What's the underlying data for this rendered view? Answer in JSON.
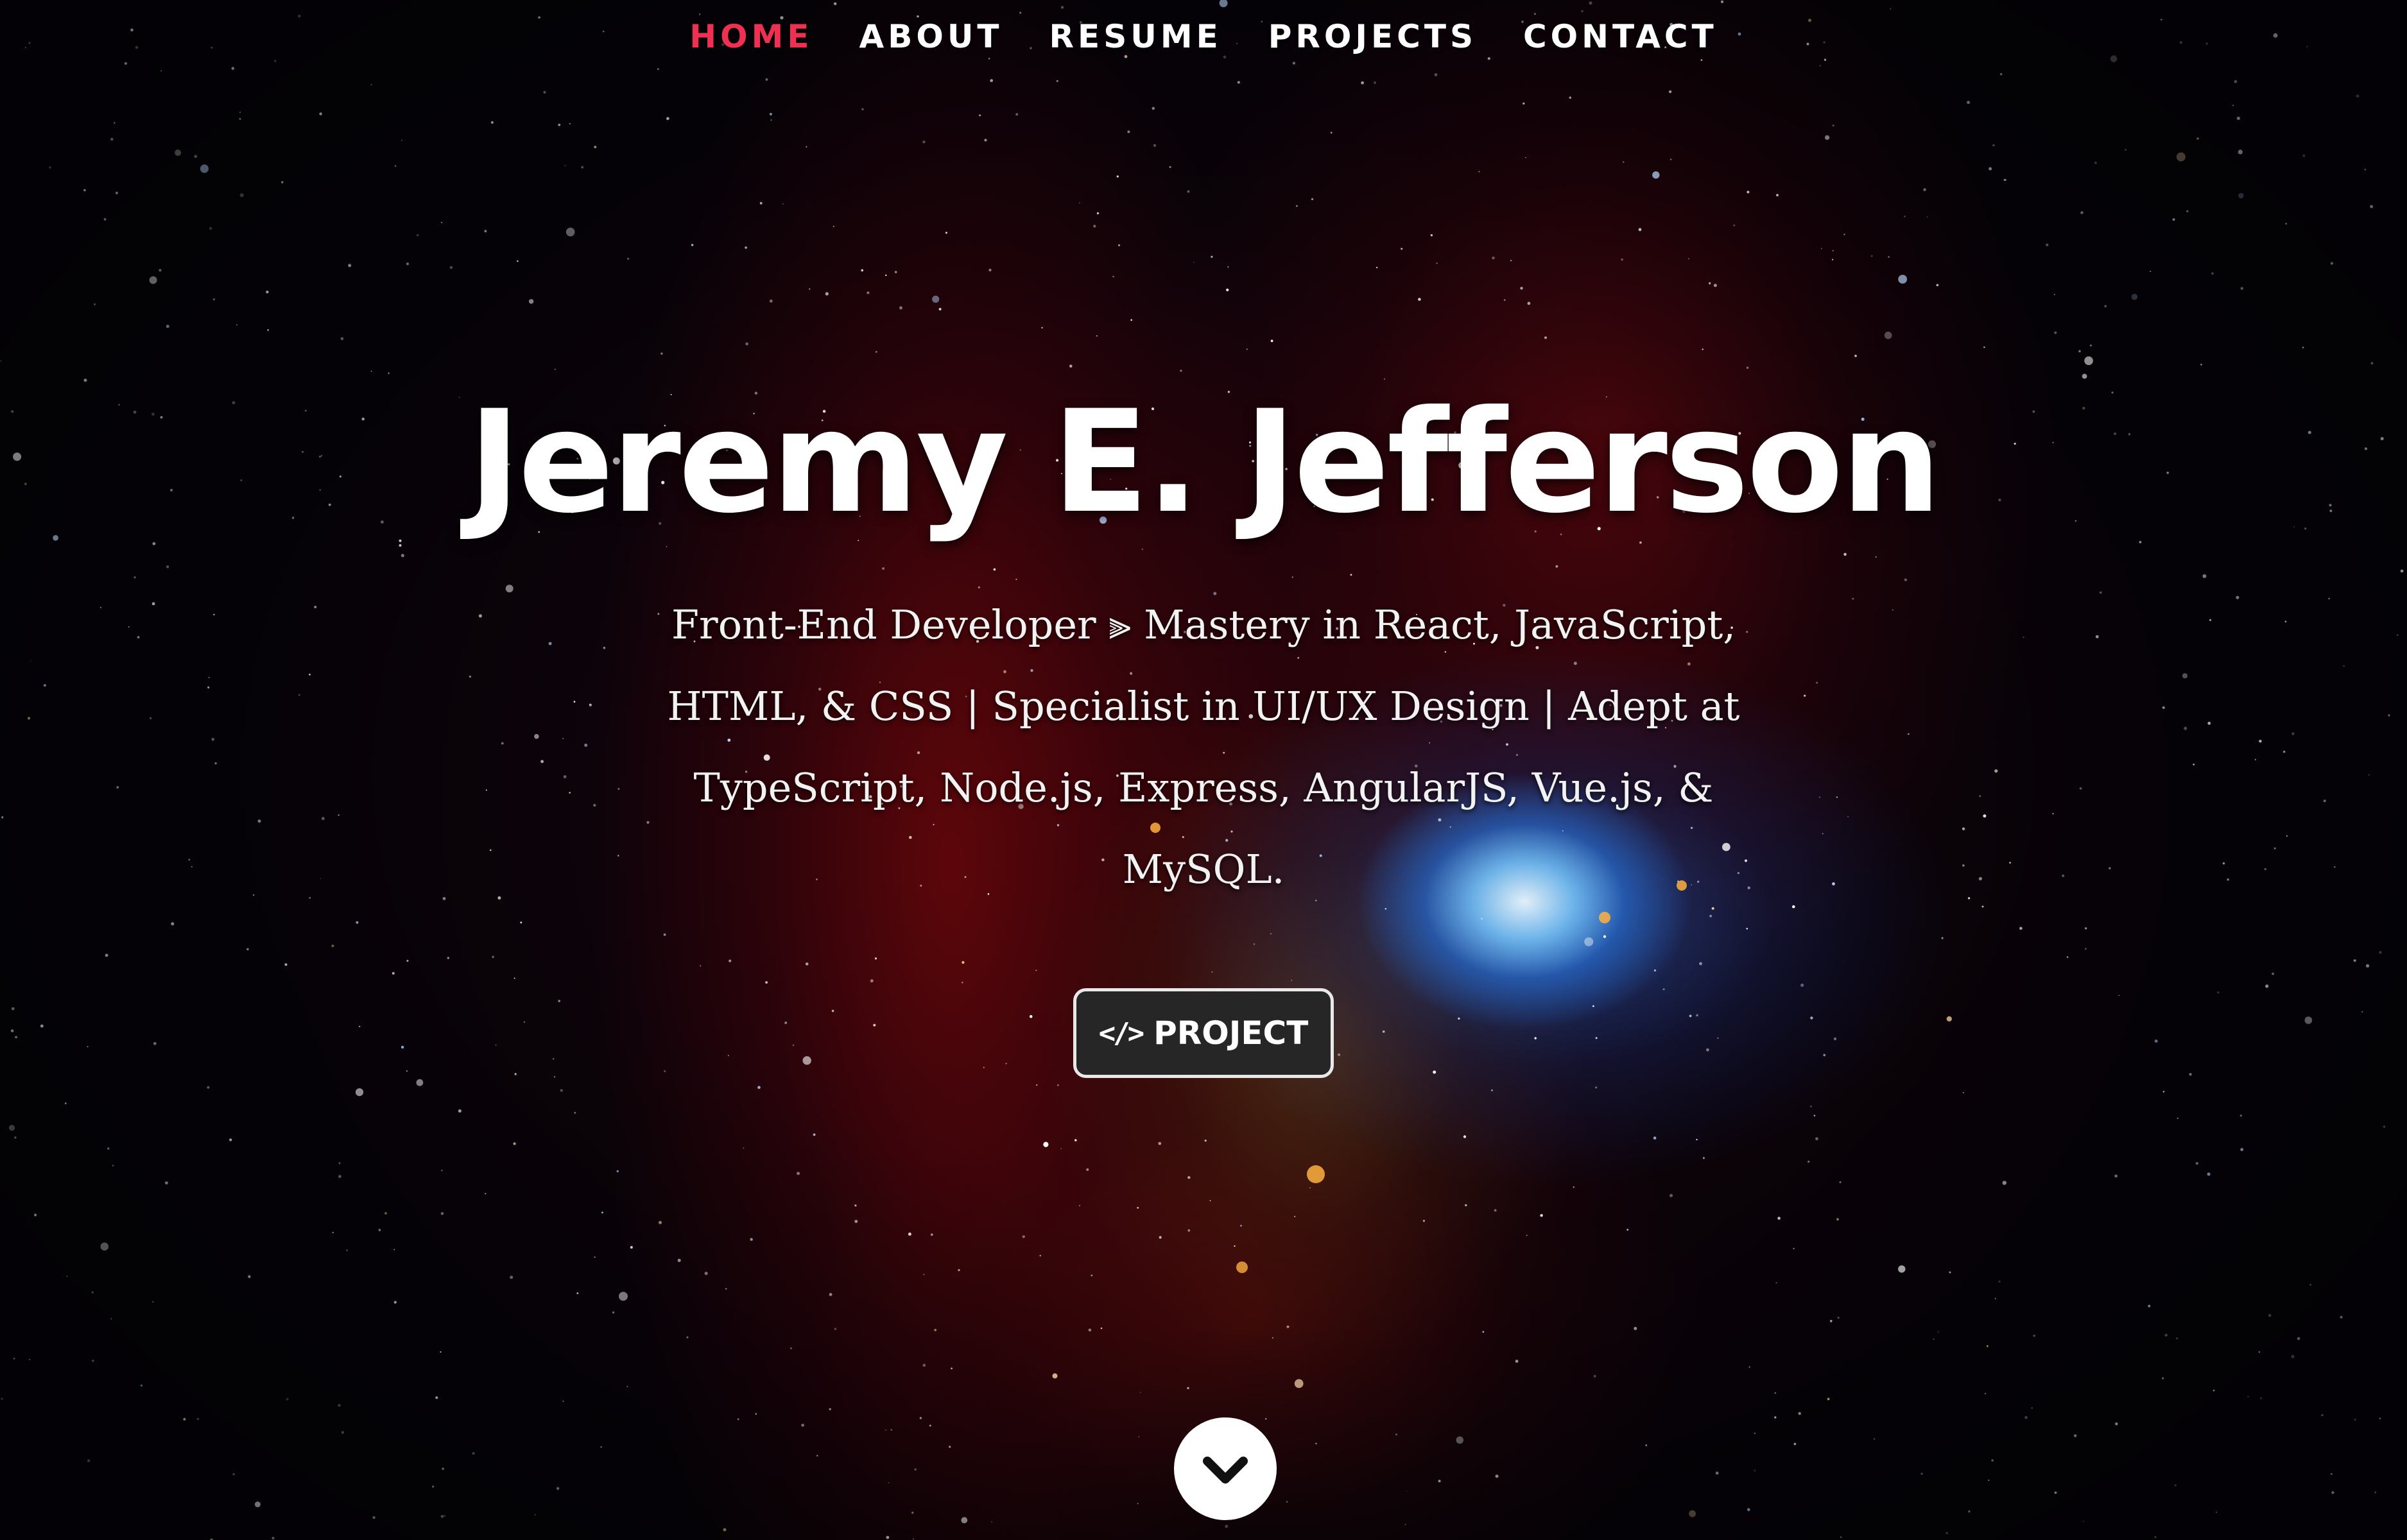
{
  "nav": {
    "items": [
      {
        "label": "HOME",
        "active": true
      },
      {
        "label": "ABOUT",
        "active": false
      },
      {
        "label": "RESUME",
        "active": false
      },
      {
        "label": "PROJECTS",
        "active": false
      },
      {
        "label": "CONTACT",
        "active": false
      }
    ],
    "active_color": "#ee3152"
  },
  "hero": {
    "name": "Jeremy E. Jefferson",
    "tagline": "Front-End Developer ⫸ Mastery in React, JavaScript, HTML, & CSS | Specialist in UI/UX Design | Adept at TypeScript, Node.js, Express, AngularJS, Vue.js, & MySQL.",
    "project_button": {
      "icon": "code-icon",
      "icon_glyph": "</>",
      "label": "PROJECT"
    },
    "scroll_button": {
      "icon": "chevron-down-icon"
    }
  }
}
